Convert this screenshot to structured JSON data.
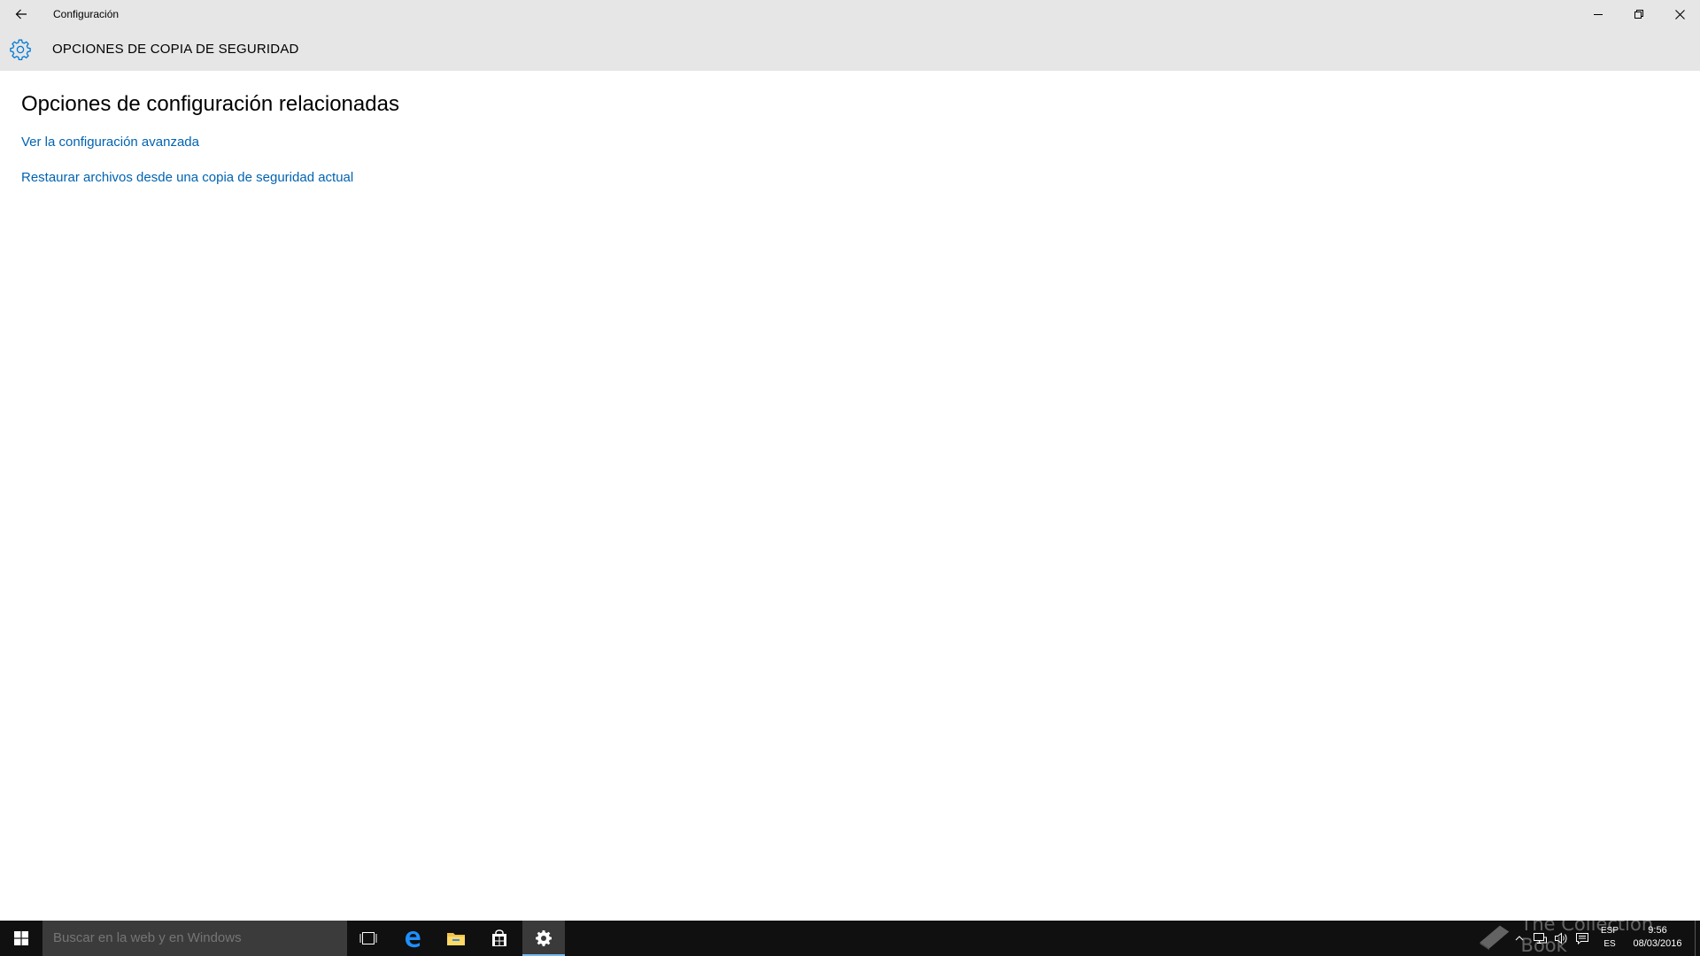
{
  "window": {
    "title": "Configuración",
    "back_icon": "arrow-left-icon",
    "minimize_icon": "minimize-icon",
    "maximize_icon": "restore-icon",
    "close_icon": "close-icon"
  },
  "header": {
    "icon": "gear-icon",
    "title": "OPCIONES DE COPIA DE SEGURIDAD"
  },
  "content": {
    "section_heading": "Opciones de configuración relacionadas",
    "links": [
      {
        "label": "Ver la configuración avanzada"
      },
      {
        "label": "Restaurar archivos desde una copia de seguridad actual"
      }
    ]
  },
  "taskbar": {
    "search_placeholder": "Buscar en la web y en Windows",
    "pinned": [
      {
        "icon": "task-view-icon"
      },
      {
        "icon": "edge-icon"
      },
      {
        "icon": "file-explorer-icon"
      },
      {
        "icon": "store-icon"
      },
      {
        "icon": "settings-gear-icon",
        "active": true
      }
    ],
    "tray": {
      "lang_top": "ESP",
      "lang_bottom": "ES",
      "time": "9:56",
      "date": "08/03/2016"
    },
    "watermark": "The Collection Book"
  },
  "colors": {
    "titlebar_bg": "#e6e6e6",
    "link": "#0063b1",
    "accent_icon": "#0078d7",
    "taskbar_bg": "#101010",
    "search_bg": "#3b3b3b"
  }
}
